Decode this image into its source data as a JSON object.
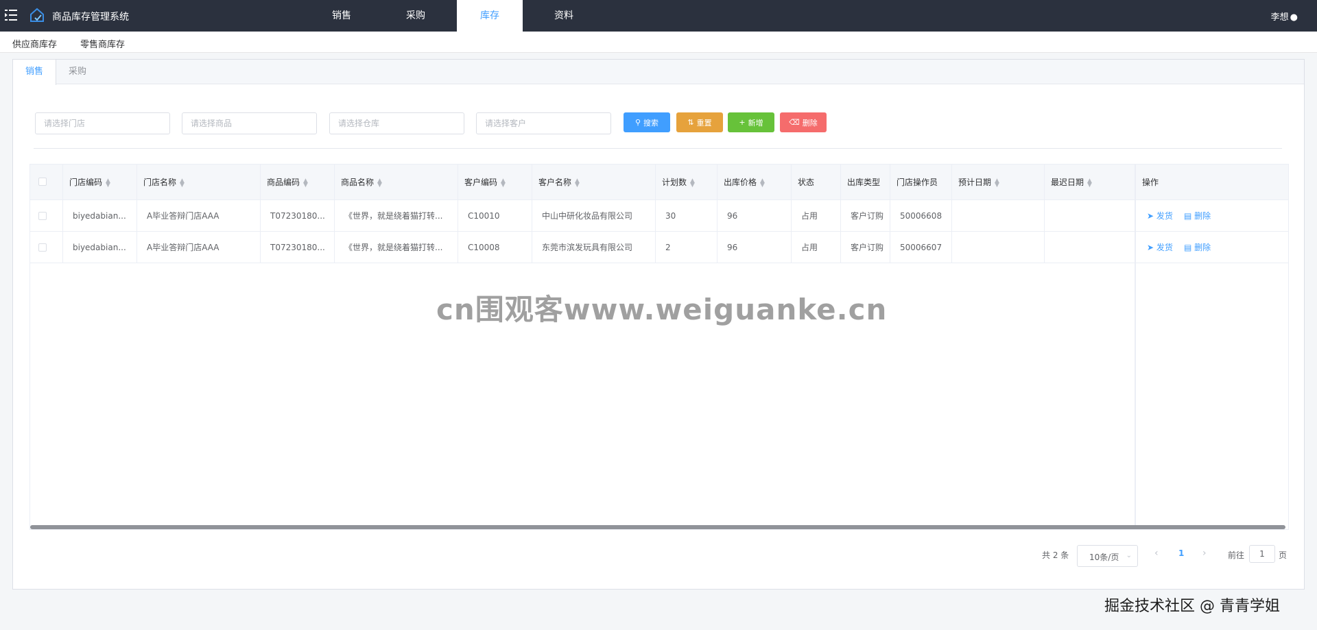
{
  "app": {
    "title": "商品库存管理系统"
  },
  "topnav": {
    "items": [
      "销售",
      "采购",
      "库存",
      "资料"
    ],
    "active_index": 2
  },
  "user": {
    "name": "李想"
  },
  "subnav": {
    "items": [
      "供应商库存",
      "零售商库存"
    ]
  },
  "tabs": {
    "items": [
      "销售",
      "采购"
    ],
    "active_index": 0
  },
  "filters": {
    "store_placeholder": "请选择门店",
    "product_placeholder": "请选择商品",
    "warehouse_placeholder": "请选择仓库",
    "customer_placeholder": "请选择客户",
    "search_label": "搜索",
    "reset_label": "重置",
    "add_label": "新增",
    "delete_label": "删除"
  },
  "table": {
    "columns": [
      "门店编码",
      "门店名称",
      "商品编码",
      "商品名称",
      "客户编码",
      "客户名称",
      "计划数",
      "出库价格",
      "状态",
      "出库类型",
      "门店操作员",
      "预计日期",
      "最迟日期",
      "操作"
    ],
    "rows": [
      {
        "store_code": "biyedabian...",
        "store_name": "A毕业答辩门店AAA",
        "product_code": "T07230180...",
        "product_name": "《世界，就是绕着猫打转...",
        "customer_code": "C10010",
        "customer_name": "中山中研化妆品有限公司",
        "planned_qty": "30",
        "out_price": "96",
        "status": "占用",
        "out_type": "客户订购",
        "operator": "50006608",
        "expected_date": "",
        "latest_date": ""
      },
      {
        "store_code": "biyedabian...",
        "store_name": "A毕业答辩门店AAA",
        "product_code": "T07230180...",
        "product_name": "《世界，就是绕着猫打转...",
        "customer_code": "C10008",
        "customer_name": "东莞市滨发玩具有限公司",
        "planned_qty": "2",
        "out_price": "96",
        "status": "占用",
        "out_type": "客户订购",
        "operator": "50006607",
        "expected_date": "",
        "latest_date": ""
      }
    ],
    "ship_label": "发货",
    "delete_label": "删除"
  },
  "watermark": "cn围观客www.weiguanke.cn",
  "pagination": {
    "total_label": "共 2 条",
    "page_size_label": "10条/页",
    "current_page": "1",
    "goto_label": "前往",
    "goto_value": "1",
    "page_suffix": "页"
  },
  "footer_mark": "掘金技术社区 @ 青青学姐",
  "colors": {
    "topbar": "#2b313e",
    "primary": "#409eff",
    "warning": "#e6a23c",
    "success": "#67c23a",
    "danger": "#f56c6c"
  }
}
